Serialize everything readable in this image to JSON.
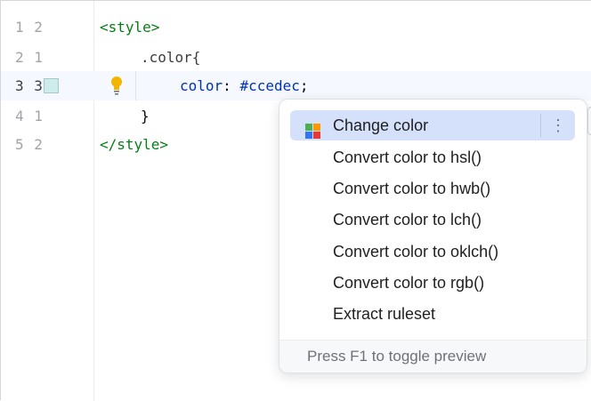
{
  "editor": {
    "lines": [
      {
        "number": "1 2",
        "parts": [
          "<style>"
        ]
      },
      {
        "number": "2 1",
        "parts": [
          ".color{"
        ]
      },
      {
        "number": "3 3",
        "parts": [
          "color",
          ": ",
          "#ccedec",
          ";"
        ]
      },
      {
        "number": "4 1",
        "parts": [
          "}"
        ]
      },
      {
        "number": "5 2",
        "parts": [
          "</style>"
        ]
      }
    ],
    "color_swatch": "#ccedec",
    "intention_icon": "lightbulb-icon"
  },
  "popup": {
    "items": [
      {
        "label": "Change color",
        "icon": "color-palette-icon",
        "selected": true
      },
      {
        "label": "Convert color to hsl()"
      },
      {
        "label": "Convert color to hwb()"
      },
      {
        "label": "Convert color to lch()"
      },
      {
        "label": "Convert color to oklch()"
      },
      {
        "label": "Convert color to rgb()"
      },
      {
        "label": "Extract ruleset"
      }
    ],
    "more_icon": "more-vertical-icon",
    "footer": "Press F1 to toggle preview"
  },
  "colors": {
    "selection": "#d5e1fb",
    "tag": "#067d17",
    "property": "#0033b3"
  }
}
